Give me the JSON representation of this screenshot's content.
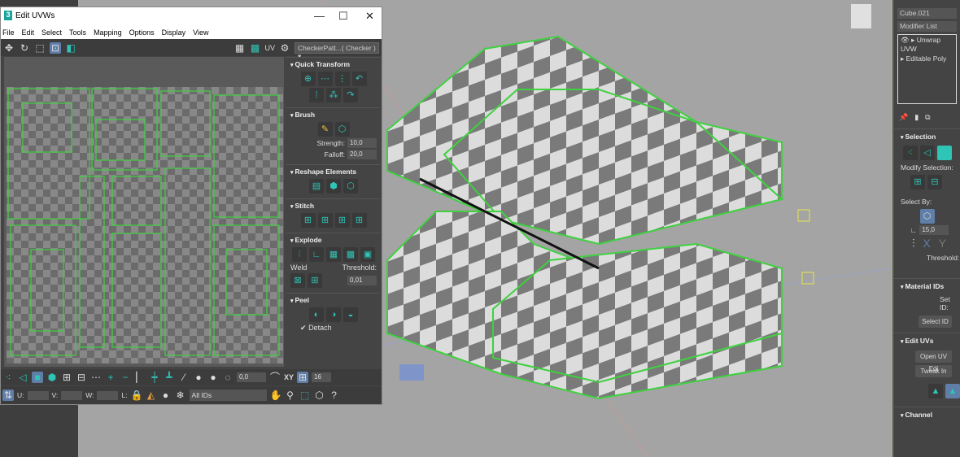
{
  "window": {
    "title": "Edit UVWs",
    "logo": "3",
    "minimize": "—",
    "maximize": "☐",
    "close": "✕"
  },
  "menu": [
    "File",
    "Edit",
    "Select",
    "Tools",
    "Mapping",
    "Options",
    "Display",
    "View"
  ],
  "toolbar": {
    "uv_label": "UV",
    "checker_select": "CheckerPatt...( Checker )"
  },
  "rollouts": {
    "quick_transform": "Quick Transform",
    "brush": {
      "title": "Brush",
      "strength_label": "Strength:",
      "strength": "10,0",
      "falloff_label": "Falloff:",
      "falloff": "20,0"
    },
    "reshape": "Reshape Elements",
    "stitch": "Stitch",
    "explode": {
      "title": "Explode",
      "weld_label": "Weld",
      "threshold_label": "Threshold:",
      "threshold": "0,01"
    },
    "peel": {
      "title": "Peel",
      "detach_label": "Detach"
    }
  },
  "bottom": {
    "soft_value": "0,0",
    "xy_label": "XY",
    "grid_value": "16",
    "u_label": "U:",
    "v_label": "V:",
    "w_label": "W:",
    "l_label": "L:",
    "ids_select": "All IDs"
  },
  "right_panel": {
    "object_name": "Cube.021",
    "modifier_list": "Modifier List",
    "stack": [
      "Unwrap UVW",
      "Editable Poly"
    ],
    "selection": "Selection",
    "modify_selection": "Modify Selection:",
    "select_by": "Select By:",
    "angle": "15,0",
    "threshold_label": "Threshold:",
    "material_ids": "Material IDs",
    "set_id": "Set ID:",
    "select_id": "Select ID",
    "edit_uvs": "Edit UVs",
    "open_uv_editor": "Open UV Edi",
    "tweak_in": "Tweak In",
    "channel": "Channel"
  },
  "colors": {
    "accent": "#2ec4b6",
    "uv_edge": "#3fd13f",
    "selected": "#5f7ea8"
  }
}
